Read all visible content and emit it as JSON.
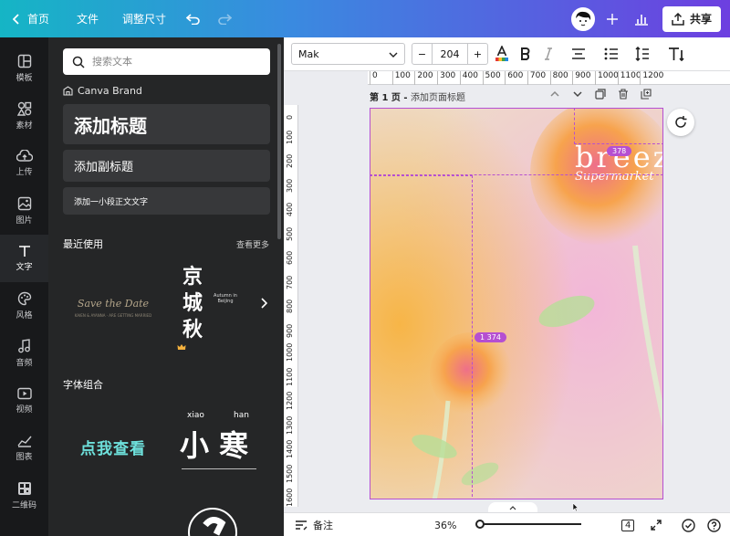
{
  "topbar": {
    "home": "首页",
    "file": "文件",
    "resize": "调整尺寸",
    "share": "共享"
  },
  "rail": [
    {
      "label": "模板",
      "icon": "template-icon"
    },
    {
      "label": "素材",
      "icon": "elements-icon"
    },
    {
      "label": "上传",
      "icon": "upload-icon"
    },
    {
      "label": "图片",
      "icon": "photo-icon"
    },
    {
      "label": "文字",
      "icon": "text-icon"
    },
    {
      "label": "风格",
      "icon": "palette-icon"
    },
    {
      "label": "音频",
      "icon": "audio-icon"
    },
    {
      "label": "视频",
      "icon": "video-icon"
    },
    {
      "label": "图表",
      "icon": "chart-icon"
    },
    {
      "label": "二维码",
      "icon": "qrcode-icon"
    }
  ],
  "panel": {
    "search_placeholder": "搜索文本",
    "brand": "Canva Brand",
    "heading": "添加标题",
    "subheading": "添加副标题",
    "body": "添加一小段正文文字",
    "recent_title": "最近使用",
    "see_more": "查看更多",
    "combo_title": "字体组合",
    "thumb1_title": "Save the Date",
    "thumb1_sub": "KAIEN & AYANNA · ARE GETTING MARRIED",
    "thumb2_chars": "京 城 秋",
    "thumb2_en": "Autumn in Beijing",
    "combo1": "点我查看",
    "combo2_pinyin_a": "xiao",
    "combo2_pinyin_b": "han",
    "combo2_chars": "小 寒"
  },
  "fontbar": {
    "font": "Mak",
    "size": "204",
    "minus": "−",
    "plus": "+"
  },
  "ruler": {
    "top": [
      "0",
      "100",
      "200",
      "300",
      "400",
      "500",
      "600",
      "700",
      "800",
      "900",
      "1000",
      "1100",
      "1200"
    ],
    "left": [
      "0",
      "100",
      "200",
      "300",
      "400",
      "500",
      "600",
      "700",
      "800",
      "900",
      "1000",
      "1100",
      "1200",
      "1300",
      "1400",
      "1500",
      "1600"
    ]
  },
  "page": {
    "label": "第 1 页 - ",
    "title_placeholder": "添加页面标题",
    "breeze": "breeze",
    "supermarket": "Supermarket",
    "badge_top": "378",
    "badge_mid": "1 374"
  },
  "bottombar": {
    "notes": "备注",
    "zoom": "36%",
    "pages": "4"
  },
  "colors": {
    "accent": "#b54fd1",
    "topbar_start": "#15b5c5",
    "topbar_end": "#6d3fe0"
  }
}
